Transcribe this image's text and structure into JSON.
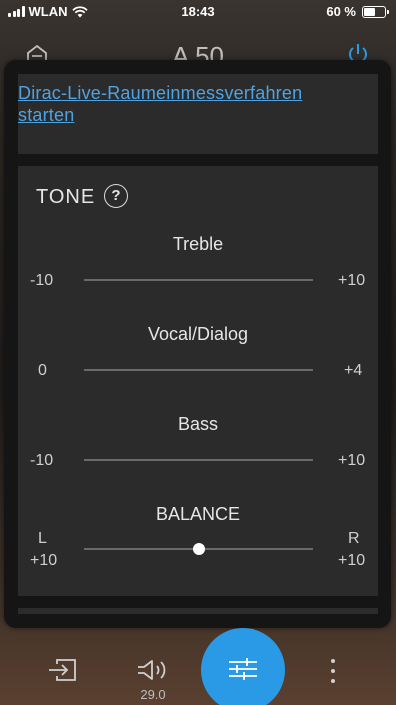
{
  "status_bar": {
    "carrier": "WLAN",
    "time": "18:43",
    "battery_text": "60 %",
    "battery_level": 0.6
  },
  "header": {
    "title": "A 50",
    "left_icon": "home-icon",
    "right_icon": "power-icon"
  },
  "dirac": {
    "link_text": "Dirac-Live-Raumeinmessverfahren starten"
  },
  "tone": {
    "title": "TONE",
    "help_symbol": "?",
    "sliders": [
      {
        "name": "treble",
        "label": "Treble",
        "min_label": "-10",
        "max_label": "+10"
      },
      {
        "name": "vocal",
        "label": "Vocal/Dialog",
        "min_label": "0",
        "max_label": "+4"
      },
      {
        "name": "bass",
        "label": "Bass",
        "min_label": "-10",
        "max_label": "+10"
      }
    ],
    "balance": {
      "label": "BALANCE",
      "left_letter": "L",
      "left_value": "+10",
      "right_letter": "R",
      "right_value": "+10",
      "position": 0.5
    }
  },
  "bottom_nav": {
    "input_icon": "input-icon",
    "volume_icon": "volume-icon",
    "volume_value": "29.0",
    "fab_icon": "sliders-icon",
    "more_icon": "more-vertical-icon",
    "fab_color": "#2b9ae6"
  },
  "colors": {
    "link": "#4fa3e3",
    "card": "#2b2b2b",
    "sheet": "#151515"
  }
}
